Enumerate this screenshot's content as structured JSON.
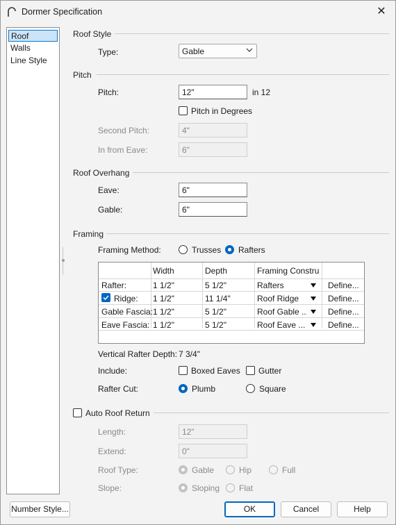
{
  "window": {
    "title": "Dormer Specification",
    "close_glyph": "✕"
  },
  "nav": {
    "items": [
      "Roof",
      "Walls",
      "Line Style"
    ]
  },
  "roof_style": {
    "heading": "Roof Style",
    "type_label": "Type:",
    "type_value": "Gable"
  },
  "pitch": {
    "heading": "Pitch",
    "pitch_label": "Pitch:",
    "pitch_value": "12\"",
    "pitch_unit": "in 12",
    "degrees_label": "Pitch in Degrees",
    "degrees_checked": false,
    "second_label": "Second Pitch:",
    "second_value": "4\"",
    "infrom_label": "In from Eave:",
    "infrom_value": "6\""
  },
  "overhang": {
    "heading": "Roof Overhang",
    "eave_label": "Eave:",
    "eave_value": "6\"",
    "gable_label": "Gable:",
    "gable_value": "6\""
  },
  "framing": {
    "heading": "Framing",
    "method_label": "Framing Method:",
    "trusses_label": "Trusses",
    "rafters_label": "Rafters",
    "method_selected": "Rafters",
    "columns": [
      "",
      "Width",
      "Depth",
      "Framing Constru",
      ""
    ],
    "rows": [
      {
        "name": "Rafter:",
        "width": "1 1/2\"",
        "depth": "5 1/2\"",
        "construction": "Rafters",
        "action": "Define...",
        "checkbox": false
      },
      {
        "name": "Ridge:",
        "width": "1 1/2\"",
        "depth": "11 1/4\"",
        "construction": "Roof Ridge",
        "action": "Define...",
        "checkbox": true
      },
      {
        "name": "Gable Fascia:",
        "width": "1 1/2\"",
        "depth": "5 1/2\"",
        "construction": "Roof Gable ...",
        "action": "Define...",
        "checkbox": false
      },
      {
        "name": "Eave Fascia:",
        "width": "1 1/2\"",
        "depth": "5 1/2\"",
        "construction": "Roof Eave ...",
        "action": "Define...",
        "checkbox": false
      }
    ],
    "vrd_label": "Vertical Rafter Depth:",
    "vrd_value": "7 3/4\"",
    "include_label": "Include:",
    "boxed_label": "Boxed Eaves",
    "boxed_checked": false,
    "gutter_label": "Gutter",
    "gutter_checked": false,
    "cut_label": "Rafter Cut:",
    "plumb_label": "Plumb",
    "square_label": "Square",
    "cut_selected": "Plumb"
  },
  "auto_return": {
    "heading": "Auto Roof Return",
    "checked": false,
    "length_label": "Length:",
    "length_value": "12\"",
    "extend_label": "Extend:",
    "extend_value": "0\"",
    "rooftype_label": "Roof Type:",
    "gable_label": "Gable",
    "hip_label": "Hip",
    "full_label": "Full",
    "rooftype_selected": "Gable",
    "slope_label": "Slope:",
    "sloping_label": "Sloping",
    "flat_label": "Flat",
    "slope_selected": "Sloping"
  },
  "buttons": {
    "number_style": "Number Style...",
    "ok": "OK",
    "cancel": "Cancel",
    "help": "Help"
  }
}
